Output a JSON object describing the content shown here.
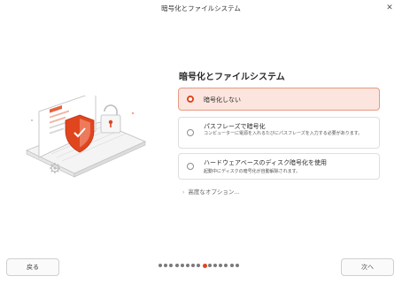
{
  "window": {
    "title": "暗号化とファイルシステム"
  },
  "heading": "暗号化とファイルシステム",
  "options": [
    {
      "label": "暗号化しない",
      "description": "",
      "selected": true
    },
    {
      "label": "パスフレーズで暗号化",
      "description": "コンピューターに電源を入れるたびにパスフレーズを入力する必要があります。",
      "selected": false
    },
    {
      "label": "ハードウェアベースのディスク暗号化を使用",
      "description": "起動中にディスクの暗号化が自動解除されます。",
      "selected": false
    }
  ],
  "advanced": {
    "label": "高度なオプション..."
  },
  "footer": {
    "back_label": "戻る",
    "next_label": "次へ"
  },
  "progress": {
    "total_steps": 15,
    "current_step": 9
  },
  "colors": {
    "accent": "#e0461e",
    "selected_bg": "#fbe5de",
    "selected_border": "#e69a83"
  },
  "icons": {
    "illustration": "laptop-shield-lock-illustration",
    "close": "close-icon",
    "gear": "gear-icon"
  }
}
